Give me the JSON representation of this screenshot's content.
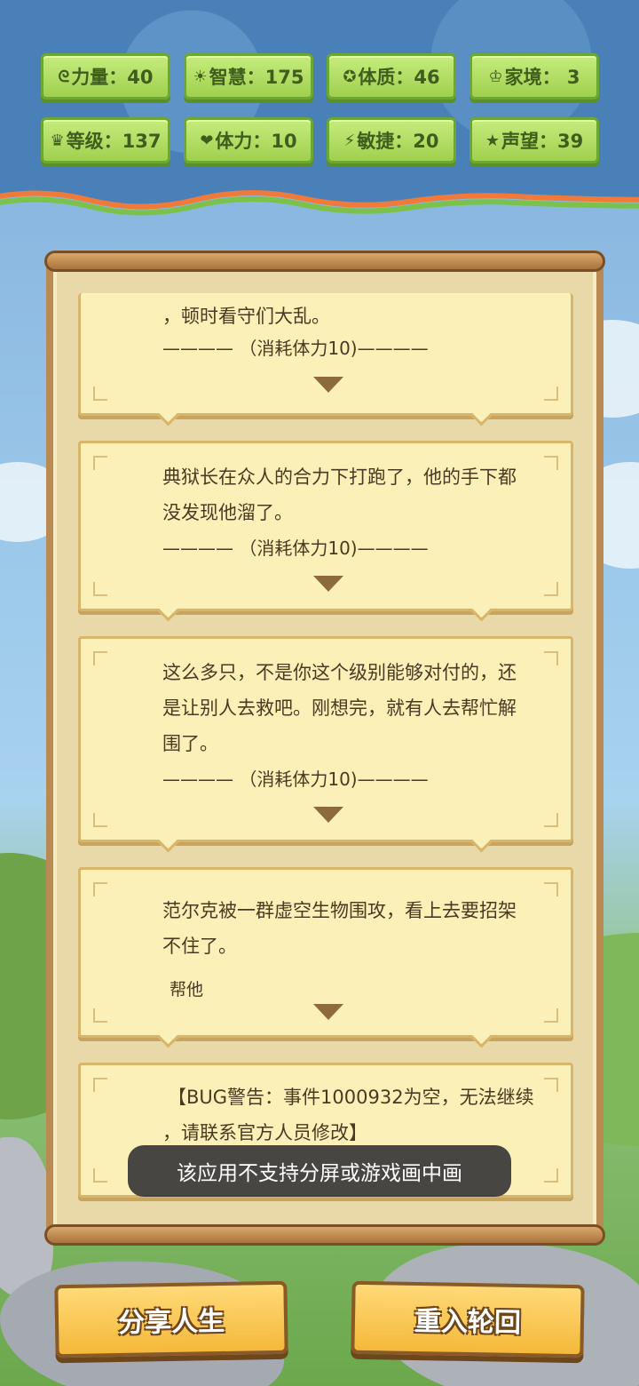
{
  "stats": [
    {
      "icon": "muscle-icon",
      "glyph": "ᘓ",
      "label": "力量：40"
    },
    {
      "icon": "bulb-icon",
      "glyph": "☀",
      "label": "智慧：175"
    },
    {
      "icon": "constitution-icon",
      "glyph": "✪",
      "label": "体质：46"
    },
    {
      "icon": "family-icon",
      "glyph": "♔",
      "label": "家境：  3"
    },
    {
      "icon": "crown-icon",
      "glyph": "♛",
      "label": "等级：137"
    },
    {
      "icon": "heart-icon",
      "glyph": "❤",
      "label": "体力：10"
    },
    {
      "icon": "lightning-icon",
      "glyph": "⚡",
      "label": "敏捷：20"
    },
    {
      "icon": "star-icon",
      "glyph": "★",
      "label": "声望：39"
    }
  ],
  "cards": [
    {
      "lines": [
        "，顿时看守们大乱。"
      ],
      "cost": "———— （消耗体力10)————"
    },
    {
      "lines": [
        "典狱长在众人的合力下打跑了，他的手下都",
        "没发现他溜了。"
      ],
      "cost": "———— （消耗体力10)————"
    },
    {
      "lines": [
        "这么多只，不是你这个级别能够对付的，还",
        "是让别人去救吧。刚想完，就有人去帮忙解",
        "围了。"
      ],
      "cost": "———— （消耗体力10)————"
    },
    {
      "lines": [
        "范尔克被一群虚空生物围攻，看上去要招架",
        "不住了。"
      ],
      "choice": "帮他"
    },
    {
      "lines": [
        "【BUG警告：事件1000932为空，无法继续",
        "，请联系官方人员修改】"
      ]
    }
  ],
  "toast": "该应用不支持分屏或游戏画中画",
  "buttons": {
    "share": "分享人生",
    "restart": "重入轮回"
  }
}
